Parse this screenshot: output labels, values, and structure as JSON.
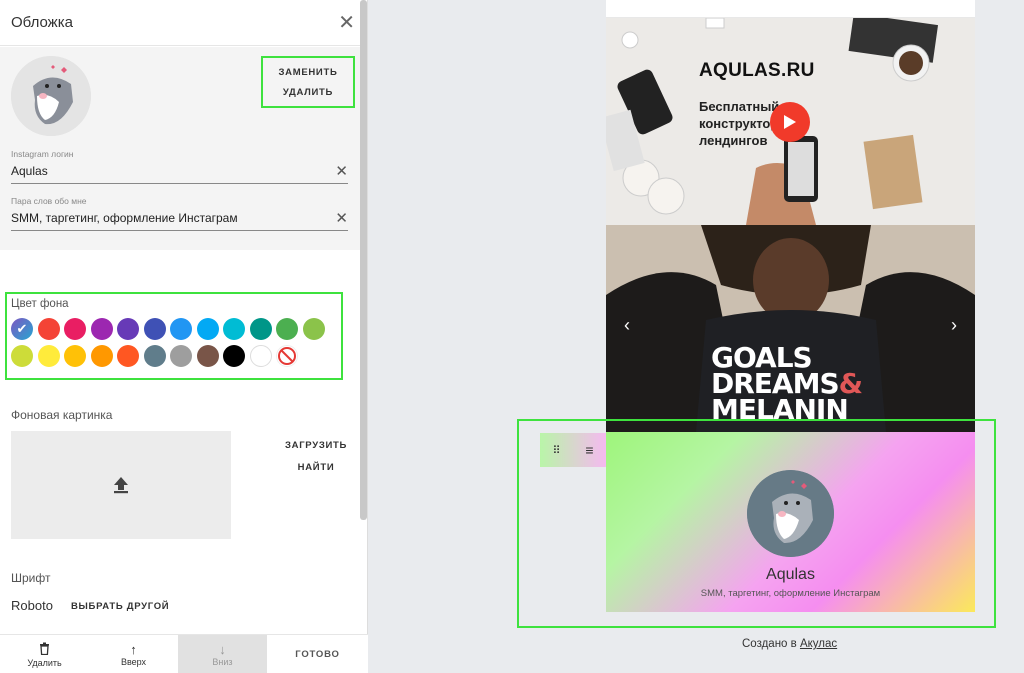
{
  "panel": {
    "title": "Обложка",
    "replace_label": "ЗАМЕНИТЬ",
    "delete_label": "УДАЛИТЬ",
    "instagram_label": "Instagram логин",
    "instagram_value": "Aqulas",
    "about_label": "Пара слов обо мне",
    "about_value": "SMM, таргетинг, оформление Инстаграм",
    "bg_color_label": "Цвет фона",
    "bg_picture_label": "Фоновая картинка",
    "upload_label": "ЗАГРУЗИТЬ",
    "find_label": "НАЙТИ",
    "font_label": "Шрифт",
    "font_name": "Roboto",
    "choose_font_label": "ВЫБРАТЬ ДРУГОЙ"
  },
  "swatches": [
    {
      "color": "#7e57c2",
      "selected": true
    },
    {
      "color": "#f44336"
    },
    {
      "color": "#e91e63"
    },
    {
      "color": "#9c27b0"
    },
    {
      "color": "#673ab7"
    },
    {
      "color": "#3f51b5"
    },
    {
      "color": "#2196f3"
    },
    {
      "color": "#03a9f4"
    },
    {
      "color": "#00bcd4"
    },
    {
      "color": "#009688"
    },
    {
      "color": "#4caf50"
    },
    {
      "color": "#8bc34a"
    },
    {
      "color": "#cddc39"
    },
    {
      "color": "#ffeb3b"
    },
    {
      "color": "#ffc107"
    },
    {
      "color": "#ff9800"
    },
    {
      "color": "#ff5722"
    },
    {
      "color": "#607d8b"
    },
    {
      "color": "#9e9e9e"
    },
    {
      "color": "#795548"
    },
    {
      "color": "#000000"
    },
    {
      "color": "#ffffff"
    },
    {
      "color": "none"
    }
  ],
  "bottom": {
    "delete": "Удалить",
    "up": "Вверх",
    "down": "Вниз",
    "done": "ГОТОВО"
  },
  "preview": {
    "video_title": "AQULAS.RU",
    "video_sub1": "Бесплатный",
    "video_sub2": "конструктор",
    "video_sub3": "лендингов",
    "shirt_line1": "GOALS",
    "shirt_line2": "DREAMS",
    "shirt_amp": "&",
    "shirt_line3": "MELANIN",
    "profile_name": "Aqulas",
    "profile_desc": "SMM, таргетинг, оформление Инстаграм"
  },
  "credit": {
    "prefix": "Создано в ",
    "link": "Акулас"
  }
}
